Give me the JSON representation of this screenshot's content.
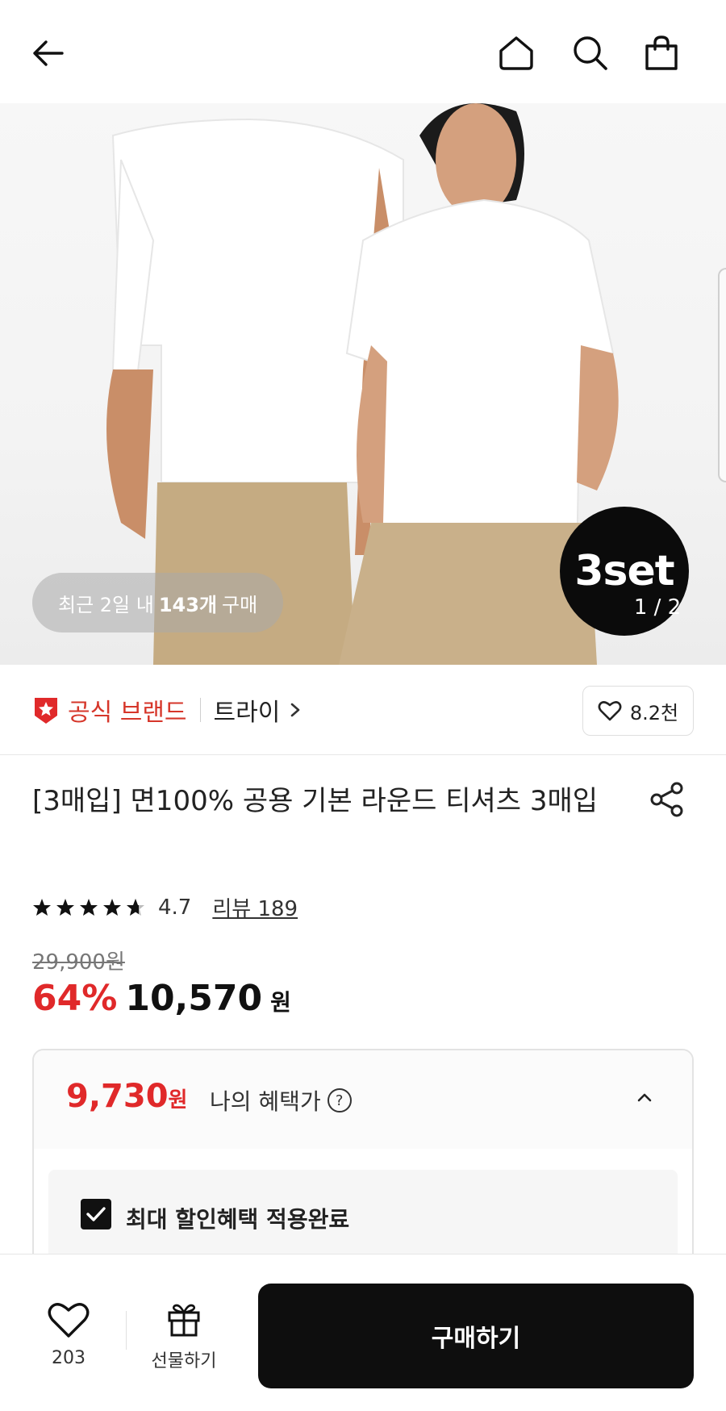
{
  "header": {
    "icons": [
      "back-arrow-icon",
      "home-icon",
      "search-icon",
      "shopping-bag-icon"
    ]
  },
  "product_image": {
    "recent_purchase_prefix": "최근 2일 내",
    "recent_purchase_count": "143개",
    "recent_purchase_suffix": "구매",
    "badge_text": "3set",
    "pager": "1 / 2"
  },
  "brand": {
    "official_label": "공식 브랜드",
    "name": "트라이",
    "likes": "8.2천"
  },
  "product": {
    "title": "[3매입] 면100% 공용 기본 라운드 티셔츠 3매입",
    "rating": "4.7",
    "review_label": "리뷰 189",
    "stars": 4.7,
    "original_price": "29,900원",
    "discount": "64%",
    "price": "10,570",
    "price_unit": "원"
  },
  "benefit": {
    "price": "9,730",
    "price_unit": "원",
    "label": "나의 혜택가",
    "help_icon": "?",
    "applied_label": "최대 할인혜택 적용완료"
  },
  "bottom_bar": {
    "wish_count": "203",
    "gift_label": "선물하기",
    "buy_label": "구매하기"
  },
  "colors": {
    "accent_red": "#e0292a",
    "brand_red": "#d6362a",
    "buy_button": "#0e0e0e"
  }
}
